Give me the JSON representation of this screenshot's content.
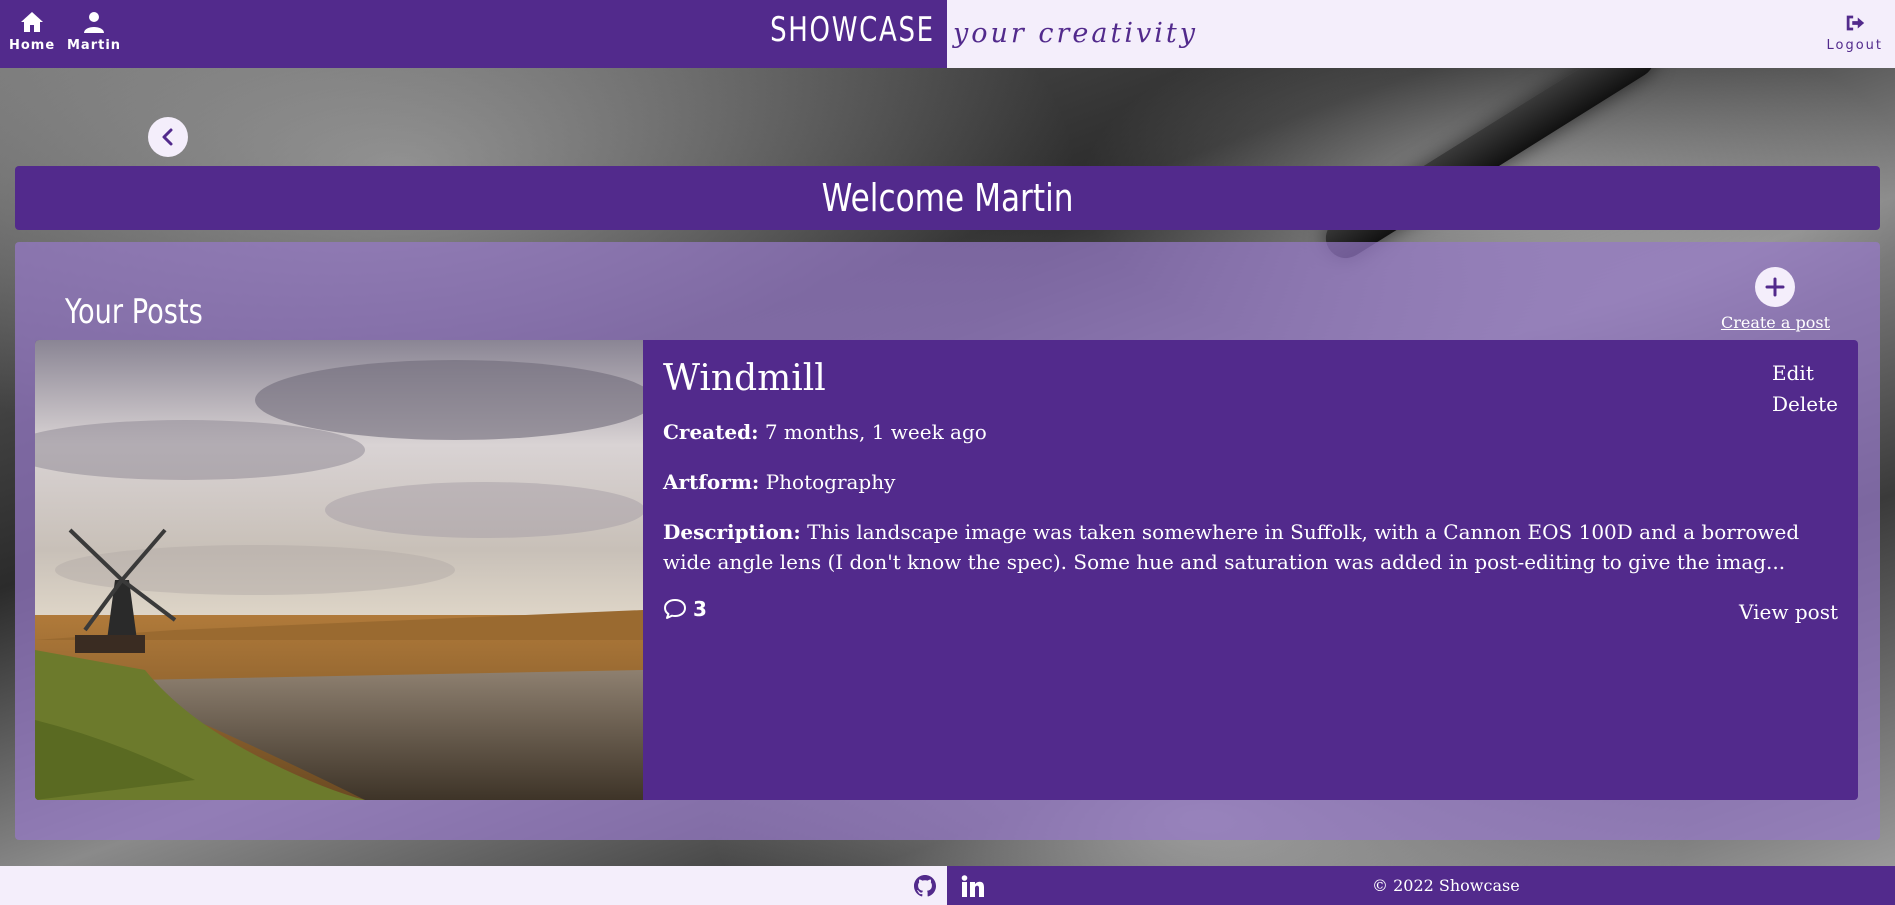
{
  "nav": {
    "home_label": "Home",
    "user_label": "Martin",
    "brand": "SHOWCASE",
    "tagline": "your creativity",
    "logout_label": "Logout"
  },
  "welcome": "Welcome Martin",
  "posts_section": {
    "title": "Your Posts",
    "create_label": "Create a post"
  },
  "post": {
    "title": "Windmill",
    "created_label": "Created:",
    "created_value": "7 months, 1 week ago",
    "artform_label": "Artform:",
    "artform_value": "Photography",
    "description_label": "Description:",
    "description_value": "This landscape image was taken somewhere in Suffolk, with a Cannon EOS 100D and a borrowed wide angle lens (I don't know the spec). Some hue and saturation was added in post-editing to give the imag...",
    "comment_count": "3",
    "edit_label": "Edit",
    "delete_label": "Delete",
    "view_label": "View post"
  },
  "footer": {
    "copyright": "© 2022 Showcase"
  },
  "colors": {
    "primary": "#522a8c",
    "light": "#f4eefb"
  },
  "icons": [
    "home-icon",
    "user-icon",
    "logout-icon",
    "chevron-left-icon",
    "plus-icon",
    "comment-icon",
    "github-icon",
    "linkedin-icon"
  ]
}
